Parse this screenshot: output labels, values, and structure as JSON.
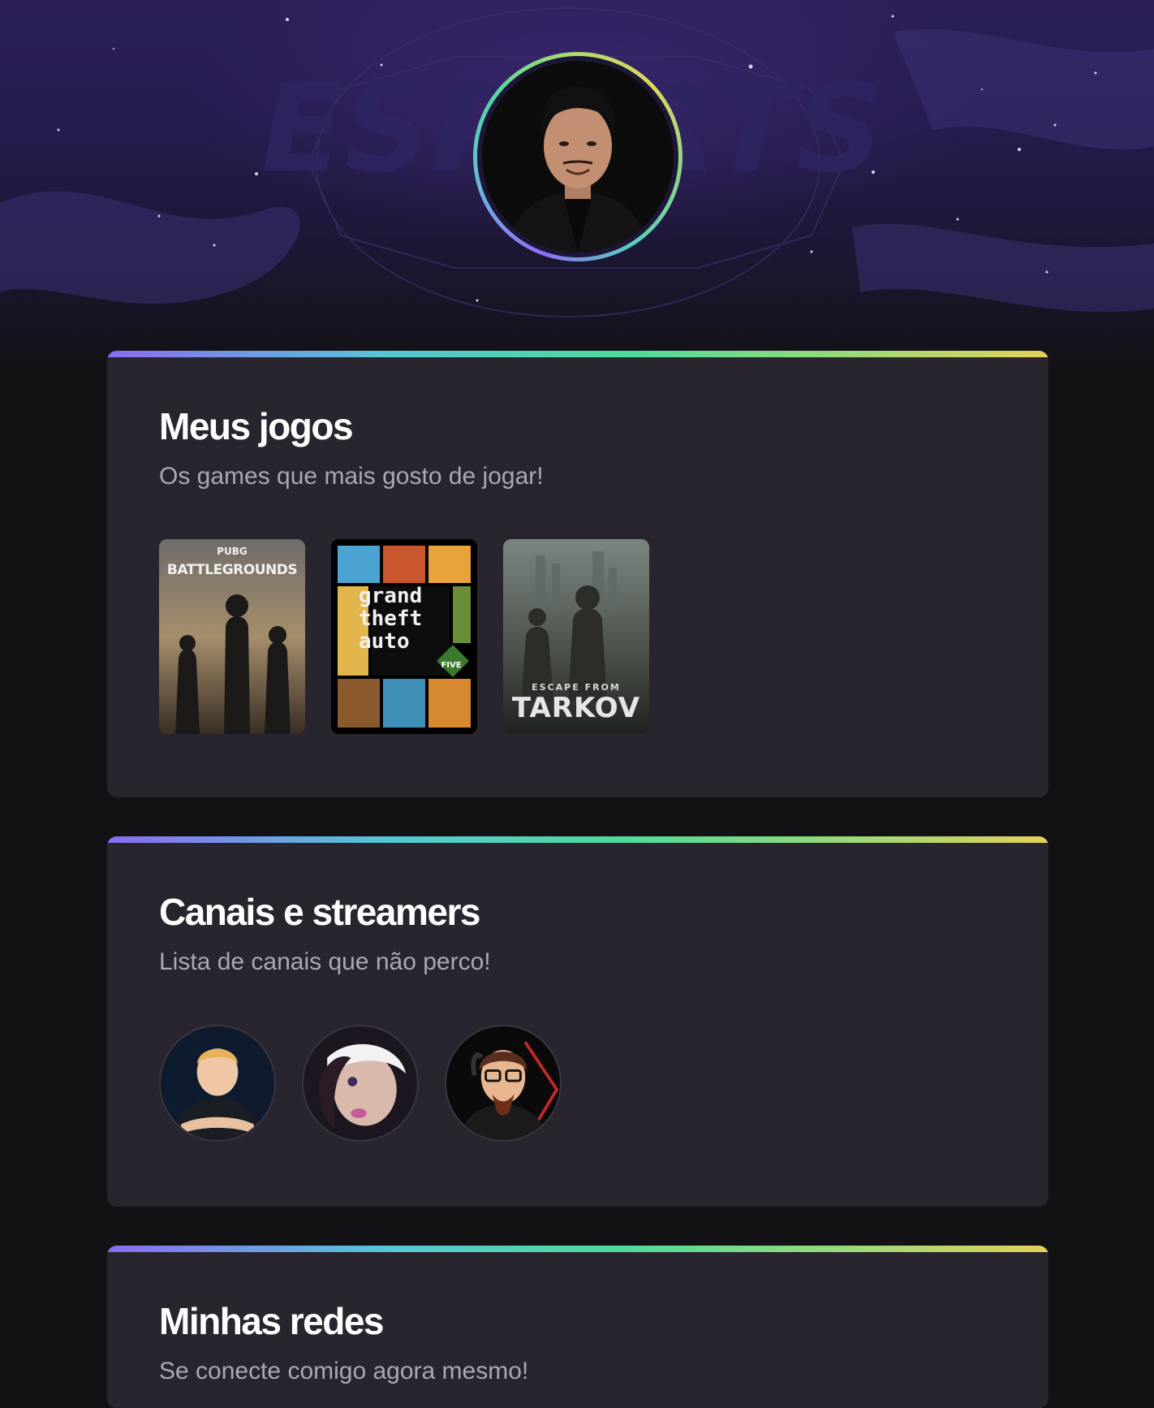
{
  "profile": {
    "avatar_alt": "Foto de perfil"
  },
  "hero": {
    "bg_logo": "ESPORTS"
  },
  "sections": {
    "games": {
      "title": "Meus jogos",
      "subtitle": "Os games que mais gosto de jogar!",
      "items": [
        {
          "name": "PUBG: Battlegrounds",
          "label_top": "PUBG",
          "label": "BATTLEGROUNDS"
        },
        {
          "name": "Grand Theft Auto V",
          "label": "grand theft auto",
          "badge": "FIVE"
        },
        {
          "name": "Escape from Tarkov",
          "label_top": "ESCAPE FROM",
          "label": "TARKOV"
        }
      ]
    },
    "streamers": {
      "title": "Canais e streamers",
      "subtitle": "Lista de canais que não perco!",
      "items": [
        {
          "name": "streamer-1"
        },
        {
          "name": "streamer-2"
        },
        {
          "name": "streamer-3"
        }
      ]
    },
    "social": {
      "title": "Minhas redes",
      "subtitle": "Se conecte comigo agora mesmo!"
    }
  },
  "colors": {
    "page_bg": "#121214",
    "card_bg": "#29252f",
    "gradient": [
      "#8b6cf2",
      "#56c7d5",
      "#4fdb9b",
      "#9fd977",
      "#e3d05a"
    ],
    "title": "#ffffff",
    "subtitle": "#a9a9b3"
  }
}
